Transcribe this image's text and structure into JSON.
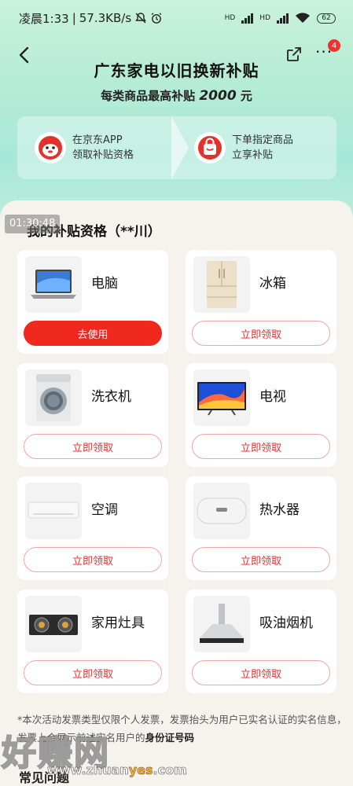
{
  "status_bar": {
    "time": "凌晨1:33",
    "speed": "57.3KB/s",
    "battery": "62",
    "hd1": "HD",
    "hd2": "HD"
  },
  "header": {
    "title": "广东家电以旧换新补贴",
    "subtitle_prefix": "每类商品最高补贴",
    "subtitle_amount": "2000",
    "subtitle_unit": "元",
    "notification_count": "4"
  },
  "steps": [
    {
      "line1": "在京东APP",
      "line2": "领取补贴资格",
      "icon": "jd-mascot-icon"
    },
    {
      "line1": "下单指定商品",
      "line2": "立享补贴",
      "icon": "shopping-bag-icon"
    }
  ],
  "overlay_time": "01:30:48",
  "section_title": "我的补贴资格（**川）",
  "products": [
    {
      "name": "电脑",
      "button": "去使用",
      "icon": "laptop-icon"
    },
    {
      "name": "冰箱",
      "button": "立即领取",
      "icon": "refrigerator-icon"
    },
    {
      "name": "洗衣机",
      "button": "立即领取",
      "icon": "washing-machine-icon"
    },
    {
      "name": "电视",
      "button": "立即领取",
      "icon": "tv-icon"
    },
    {
      "name": "空调",
      "button": "立即领取",
      "icon": "air-conditioner-icon"
    },
    {
      "name": "热水器",
      "button": "立即领取",
      "icon": "water-heater-icon"
    },
    {
      "name": "家用灶具",
      "button": "立即领取",
      "icon": "gas-stove-icon"
    },
    {
      "name": "吸油烟机",
      "button": "立即领取",
      "icon": "range-hood-icon"
    }
  ],
  "notice": {
    "text1": "*本次活动发票类型仅限个人发票，发票抬头为用户已实名认证的实名",
    "text2": "信息，发票上会展示前述实名用户的",
    "bold": "身份证号码"
  },
  "faq_title": "常见问题",
  "watermark": {
    "big": "好赚网",
    "small_prefix": "www.zhuan",
    "small_highlight": "yes",
    "small_suffix": ".com"
  },
  "colors": {
    "primary_red": "#f0291f",
    "hero_green": "#b6ecd6",
    "background": "#f6f3ee"
  }
}
